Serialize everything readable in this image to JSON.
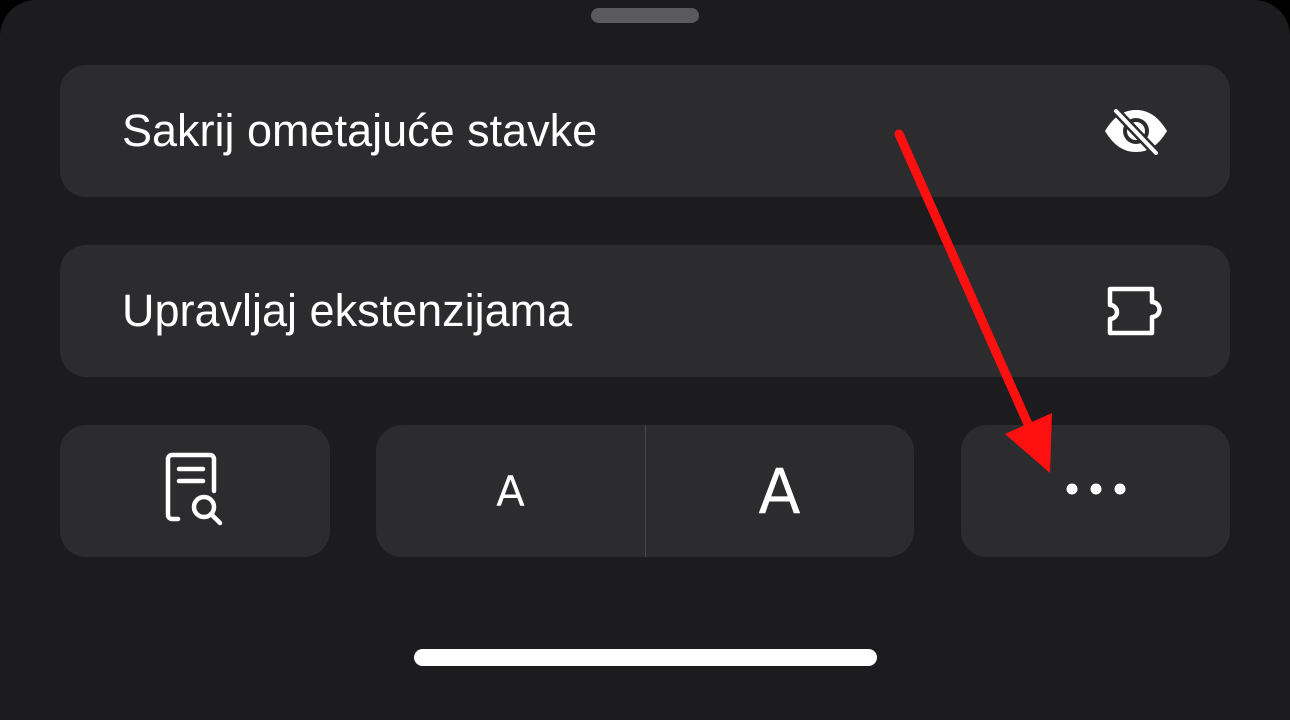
{
  "menu": {
    "hide_distracting_label": "Sakrij ometajuće stavke",
    "hide_distracting_icon": "eye-slash-icon",
    "manage_extensions_label": "Upravljaj ekstenzijama",
    "manage_extensions_icon": "puzzle-piece-icon"
  },
  "toolbar": {
    "reader_icon": "document-search-icon",
    "font_smaller_label": "A",
    "font_larger_label": "A",
    "more_icon": "ellipsis-icon"
  },
  "annotation": {
    "arrow_color": "#ff1010",
    "arrow_target": "more-button"
  },
  "colors": {
    "sheet_background": "#1c1c1e",
    "row_background": "#2c2c2e",
    "text": "#ffffff"
  }
}
